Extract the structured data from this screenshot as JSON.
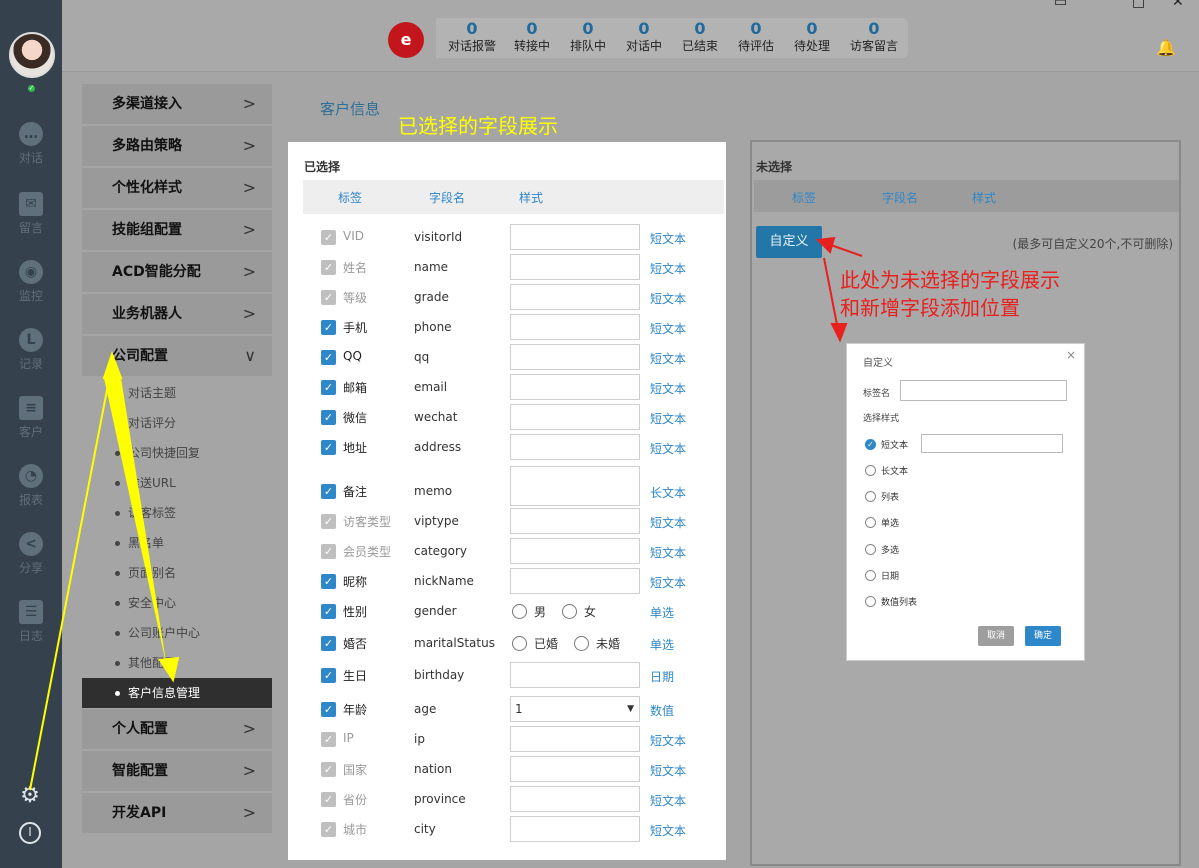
{
  "window": {
    "controls": [
      "▭",
      "□",
      "✕"
    ]
  },
  "rail": {
    "nav": [
      {
        "icon": "chat-icon",
        "glyph": "…",
        "label": "对话"
      },
      {
        "icon": "mail-icon",
        "glyph": "✉",
        "label": "留言"
      },
      {
        "icon": "eye-icon",
        "glyph": "◉",
        "label": "监控"
      },
      {
        "icon": "clock-icon",
        "glyph": "L",
        "label": "记录"
      },
      {
        "icon": "contact-card-icon",
        "glyph": "≡",
        "label": "客户"
      },
      {
        "icon": "pie-chart-icon",
        "glyph": "◔",
        "label": "报表"
      },
      {
        "icon": "share-icon",
        "glyph": "<",
        "label": "分享"
      },
      {
        "icon": "clipboard-icon",
        "glyph": "☰",
        "label": "日志"
      }
    ],
    "online_mark": "✓",
    "gear_glyph": "⚙",
    "power_glyph": "I"
  },
  "topbar": {
    "logo": "e",
    "stats": [
      {
        "value": "0",
        "label": "对话报警"
      },
      {
        "value": "0",
        "label": "转接中"
      },
      {
        "value": "0",
        "label": "排队中"
      },
      {
        "value": "0",
        "label": "对话中"
      },
      {
        "value": "0",
        "label": "已结束"
      },
      {
        "value": "0",
        "label": "待评估"
      },
      {
        "value": "0",
        "label": "待处理"
      },
      {
        "value": "0",
        "label": "访客留言"
      }
    ],
    "bell": "🔔"
  },
  "menu": {
    "chevron_right": ">",
    "chevron_down": "∨",
    "items_top": [
      "多渠道接入",
      "多路由策略",
      "个性化样式",
      "技能组配置",
      "ACD智能分配",
      "业务机器人"
    ],
    "open_group": "公司配置",
    "sub_items": [
      "对话主题",
      "对话评分",
      "公司快捷回复",
      "推送URL",
      "访客标签",
      "黑名单",
      "页面别名",
      "安全中心",
      "公司账户中心",
      "其他配置",
      "客户信息管理"
    ],
    "items_bottom": [
      "个人配置",
      "智能配置",
      "开发API"
    ]
  },
  "content": {
    "page_title": "客户信息",
    "yellow_note": "已选择的字段展示"
  },
  "selected_panel": {
    "title": "已选择",
    "headers": [
      "标签",
      "字段名",
      "样式"
    ],
    "check": "✓",
    "rows": [
      {
        "label": "VID",
        "field": "visitorId",
        "style": "短文本",
        "disabled": true,
        "kind": "text"
      },
      {
        "label": "姓名",
        "field": "name",
        "style": "短文本",
        "disabled": true,
        "kind": "text"
      },
      {
        "label": "等级",
        "field": "grade",
        "style": "短文本",
        "disabled": true,
        "kind": "text"
      },
      {
        "label": "手机",
        "field": "phone",
        "style": "短文本",
        "disabled": false,
        "kind": "text"
      },
      {
        "label": "QQ",
        "field": "qq",
        "style": "短文本",
        "disabled": false,
        "kind": "text"
      },
      {
        "label": "邮箱",
        "field": "email",
        "style": "短文本",
        "disabled": false,
        "kind": "text"
      },
      {
        "label": "微信",
        "field": "wechat",
        "style": "短文本",
        "disabled": false,
        "kind": "text"
      },
      {
        "label": "地址",
        "field": "address",
        "style": "短文本",
        "disabled": false,
        "kind": "text"
      },
      {
        "label": "备注",
        "field": "memo",
        "style": "长文本",
        "disabled": false,
        "kind": "textarea"
      },
      {
        "label": "访客类型",
        "field": "viptype",
        "style": "短文本",
        "disabled": true,
        "kind": "text"
      },
      {
        "label": "会员类型",
        "field": "category",
        "style": "短文本",
        "disabled": true,
        "kind": "text"
      },
      {
        "label": "昵称",
        "field": "nickName",
        "style": "短文本",
        "disabled": false,
        "kind": "text"
      },
      {
        "label": "性别",
        "field": "gender",
        "style": "单选",
        "disabled": false,
        "kind": "radio",
        "options": [
          "男",
          "女"
        ]
      },
      {
        "label": "婚否",
        "field": "maritalStatus",
        "style": "单选",
        "disabled": false,
        "kind": "radio",
        "options": [
          "已婚",
          "未婚"
        ]
      },
      {
        "label": "生日",
        "field": "birthday",
        "style": "日期",
        "disabled": false,
        "kind": "text"
      },
      {
        "label": "年龄",
        "field": "age",
        "style": "数值",
        "disabled": false,
        "kind": "select",
        "value": "1",
        "arrow": "▼"
      },
      {
        "label": "IP",
        "field": "ip",
        "style": "短文本",
        "disabled": true,
        "kind": "text"
      },
      {
        "label": "国家",
        "field": "nation",
        "style": "短文本",
        "disabled": true,
        "kind": "text"
      },
      {
        "label": "省份",
        "field": "province",
        "style": "短文本",
        "disabled": true,
        "kind": "text"
      },
      {
        "label": "城市",
        "field": "city",
        "style": "短文本",
        "disabled": true,
        "kind": "text"
      }
    ]
  },
  "unselected_panel": {
    "title": "未选择",
    "headers": [
      "标签",
      "字段名",
      "样式"
    ],
    "custom_button": "自定义",
    "limit_note": "(最多可自定义20个,不可删除)",
    "red_note": [
      "此处为未选择的字段展示",
      "和新增字段添加位置"
    ]
  },
  "dialog": {
    "title": "自定义",
    "close": "×",
    "tag_name_label": "标签名",
    "style_label": "选择样式",
    "options": [
      "短文本",
      "长文本",
      "列表",
      "单选",
      "多选",
      "日期",
      "数值列表"
    ],
    "checked_mark": "✓",
    "cancel": "取消",
    "confirm": "确定"
  },
  "colors": {
    "accent": "#2e87c8",
    "rail": "#35424d",
    "annotation_yellow": "#ffff00",
    "annotation_red": "#e8201e",
    "brand_red": "#c3161c"
  }
}
